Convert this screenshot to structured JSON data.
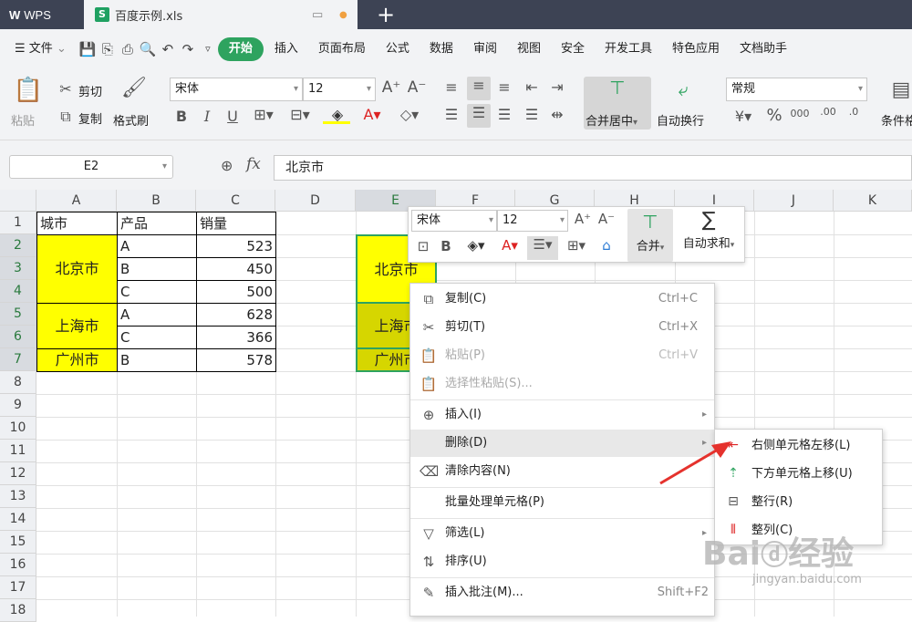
{
  "app": {
    "name": "WPS"
  },
  "document_tab": {
    "name": "百度示例.xls",
    "badge": "S"
  },
  "menu": [
    "文件",
    "开始",
    "插入",
    "页面布局",
    "公式",
    "数据",
    "审阅",
    "视图",
    "安全",
    "开发工具",
    "特色应用",
    "文档助手"
  ],
  "ribbon": {
    "paste": "粘贴",
    "cut": "剪切",
    "copy": "复制",
    "format_painter": "格式刷",
    "font_name": "宋体",
    "font_size": "12",
    "merge_center": "合并居中",
    "wrap_text": "自动换行",
    "number_format": "常规",
    "conditional": "条件格式"
  },
  "formula": {
    "cell_ref": "E2",
    "fx": "fx",
    "value": "北京市"
  },
  "columns": [
    "A",
    "B",
    "C",
    "D",
    "E",
    "F",
    "G",
    "H",
    "I",
    "J",
    "K"
  ],
  "rows": [
    "1",
    "2",
    "3",
    "4",
    "5",
    "6",
    "7",
    "8",
    "9",
    "10",
    "11",
    "12",
    "13",
    "14",
    "15",
    "16",
    "17",
    "18"
  ],
  "table": {
    "headers": [
      "城市",
      "产品",
      "销量"
    ],
    "cities": [
      "北京市",
      "上海市",
      "广州市"
    ],
    "products": [
      "A",
      "B",
      "C",
      "A",
      "C",
      "B"
    ],
    "sales": [
      "523",
      "450",
      "500",
      "628",
      "366",
      "578"
    ]
  },
  "e_column": {
    "c1": "北京市",
    "c2": "上海市",
    "c3": "广州市"
  },
  "mini_toolbar": {
    "font_name": "宋体",
    "font_size": "12",
    "merge": "合并",
    "autosum": "自动求和"
  },
  "context_menu": [
    {
      "label": "复制(C)",
      "shortcut": "Ctrl+C"
    },
    {
      "label": "剪切(T)",
      "shortcut": "Ctrl+X"
    },
    {
      "label": "粘贴(P)",
      "shortcut": "Ctrl+V"
    },
    {
      "label": "选择性粘贴(S)...",
      "shortcut": ""
    },
    {
      "label": "插入(I)",
      "shortcut": ""
    },
    {
      "label": "删除(D)",
      "shortcut": ""
    },
    {
      "label": "清除内容(N)",
      "shortcut": ""
    },
    {
      "label": "批量处理单元格(P)",
      "shortcut": ""
    },
    {
      "label": "筛选(L)",
      "shortcut": ""
    },
    {
      "label": "排序(U)",
      "shortcut": ""
    },
    {
      "label": "插入批注(M)...",
      "shortcut": "Shift+F2"
    }
  ],
  "submenu": [
    "右侧单元格左移(L)",
    "下方单元格上移(U)",
    "整行(R)",
    "整列(C)"
  ],
  "colors": {
    "accent": "#2ea35f",
    "highlight": "#ffff00",
    "arrow": "#e5322d",
    "titlebar": "#3d4354"
  }
}
